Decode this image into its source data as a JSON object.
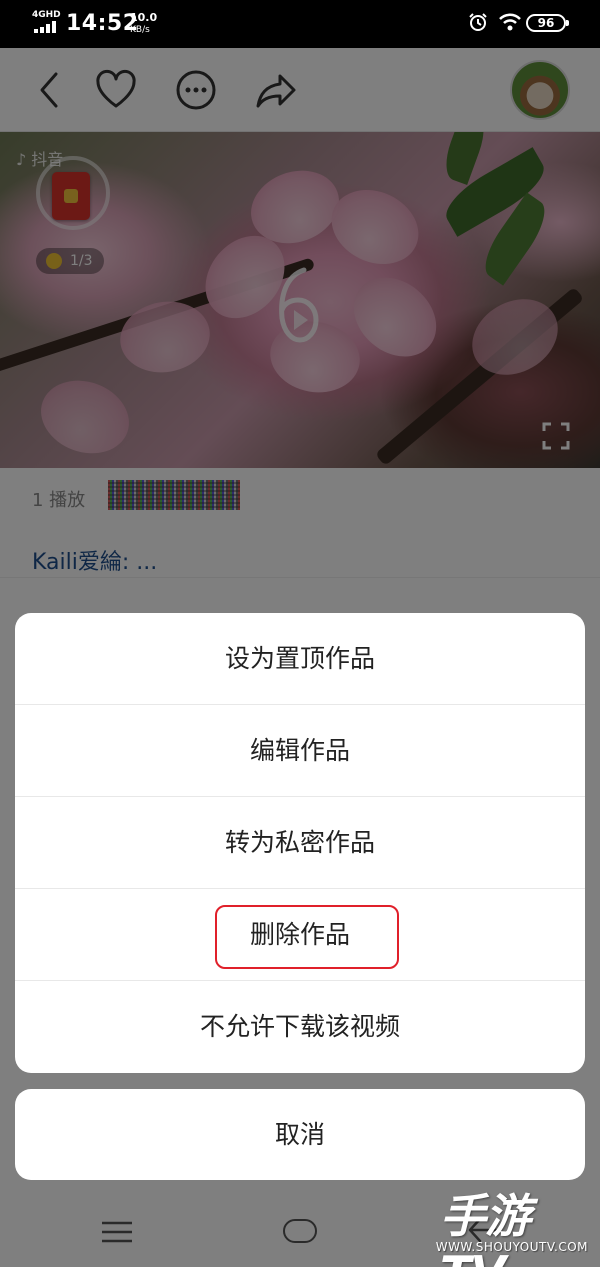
{
  "status_bar": {
    "network": "4GHD",
    "time": "14:52",
    "speed_value": "10.0",
    "speed_unit": "KB/s",
    "battery": "96"
  },
  "top_bar": {
    "icons": [
      "back-icon",
      "heart-icon",
      "more-icon",
      "share-icon"
    ]
  },
  "video": {
    "app_logo": "♪ 抖音",
    "coin_progress": "1/3"
  },
  "post": {
    "plays": "1 播放",
    "caption": "Kaili爱綸: ..."
  },
  "action_sheet": {
    "items": [
      {
        "label": "设为置顶作品"
      },
      {
        "label": "编辑作品"
      },
      {
        "label": "转为私密作品"
      },
      {
        "label": "删除作品",
        "highlighted": true
      },
      {
        "label": "不允许下载该视频"
      }
    ],
    "cancel": "取消"
  },
  "watermark": {
    "main": "手游TV",
    "site": "WWW.SHOUYOUTV.COM"
  },
  "colors": {
    "highlight": "#e0202a",
    "caption": "#1f4e8c"
  }
}
